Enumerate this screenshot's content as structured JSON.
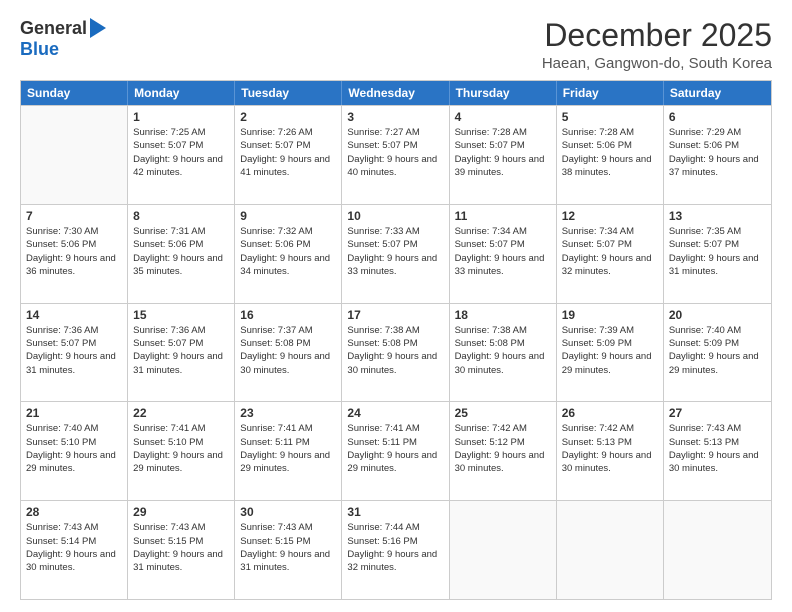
{
  "header": {
    "logo_general": "General",
    "logo_blue": "Blue",
    "month_title": "December 2025",
    "subtitle": "Haean, Gangwon-do, South Korea"
  },
  "weekdays": [
    "Sunday",
    "Monday",
    "Tuesday",
    "Wednesday",
    "Thursday",
    "Friday",
    "Saturday"
  ],
  "rows": [
    [
      {
        "day": "",
        "sunrise": "",
        "sunset": "",
        "daylight": ""
      },
      {
        "day": "1",
        "sunrise": "7:25 AM",
        "sunset": "5:07 PM",
        "daylight": "9 hours and 42 minutes."
      },
      {
        "day": "2",
        "sunrise": "7:26 AM",
        "sunset": "5:07 PM",
        "daylight": "9 hours and 41 minutes."
      },
      {
        "day": "3",
        "sunrise": "7:27 AM",
        "sunset": "5:07 PM",
        "daylight": "9 hours and 40 minutes."
      },
      {
        "day": "4",
        "sunrise": "7:28 AM",
        "sunset": "5:07 PM",
        "daylight": "9 hours and 39 minutes."
      },
      {
        "day": "5",
        "sunrise": "7:28 AM",
        "sunset": "5:06 PM",
        "daylight": "9 hours and 38 minutes."
      },
      {
        "day": "6",
        "sunrise": "7:29 AM",
        "sunset": "5:06 PM",
        "daylight": "9 hours and 37 minutes."
      }
    ],
    [
      {
        "day": "7",
        "sunrise": "7:30 AM",
        "sunset": "5:06 PM",
        "daylight": "9 hours and 36 minutes."
      },
      {
        "day": "8",
        "sunrise": "7:31 AM",
        "sunset": "5:06 PM",
        "daylight": "9 hours and 35 minutes."
      },
      {
        "day": "9",
        "sunrise": "7:32 AM",
        "sunset": "5:06 PM",
        "daylight": "9 hours and 34 minutes."
      },
      {
        "day": "10",
        "sunrise": "7:33 AM",
        "sunset": "5:07 PM",
        "daylight": "9 hours and 33 minutes."
      },
      {
        "day": "11",
        "sunrise": "7:34 AM",
        "sunset": "5:07 PM",
        "daylight": "9 hours and 33 minutes."
      },
      {
        "day": "12",
        "sunrise": "7:34 AM",
        "sunset": "5:07 PM",
        "daylight": "9 hours and 32 minutes."
      },
      {
        "day": "13",
        "sunrise": "7:35 AM",
        "sunset": "5:07 PM",
        "daylight": "9 hours and 31 minutes."
      }
    ],
    [
      {
        "day": "14",
        "sunrise": "7:36 AM",
        "sunset": "5:07 PM",
        "daylight": "9 hours and 31 minutes."
      },
      {
        "day": "15",
        "sunrise": "7:36 AM",
        "sunset": "5:07 PM",
        "daylight": "9 hours and 31 minutes."
      },
      {
        "day": "16",
        "sunrise": "7:37 AM",
        "sunset": "5:08 PM",
        "daylight": "9 hours and 30 minutes."
      },
      {
        "day": "17",
        "sunrise": "7:38 AM",
        "sunset": "5:08 PM",
        "daylight": "9 hours and 30 minutes."
      },
      {
        "day": "18",
        "sunrise": "7:38 AM",
        "sunset": "5:08 PM",
        "daylight": "9 hours and 30 minutes."
      },
      {
        "day": "19",
        "sunrise": "7:39 AM",
        "sunset": "5:09 PM",
        "daylight": "9 hours and 29 minutes."
      },
      {
        "day": "20",
        "sunrise": "7:40 AM",
        "sunset": "5:09 PM",
        "daylight": "9 hours and 29 minutes."
      }
    ],
    [
      {
        "day": "21",
        "sunrise": "7:40 AM",
        "sunset": "5:10 PM",
        "daylight": "9 hours and 29 minutes."
      },
      {
        "day": "22",
        "sunrise": "7:41 AM",
        "sunset": "5:10 PM",
        "daylight": "9 hours and 29 minutes."
      },
      {
        "day": "23",
        "sunrise": "7:41 AM",
        "sunset": "5:11 PM",
        "daylight": "9 hours and 29 minutes."
      },
      {
        "day": "24",
        "sunrise": "7:41 AM",
        "sunset": "5:11 PM",
        "daylight": "9 hours and 29 minutes."
      },
      {
        "day": "25",
        "sunrise": "7:42 AM",
        "sunset": "5:12 PM",
        "daylight": "9 hours and 30 minutes."
      },
      {
        "day": "26",
        "sunrise": "7:42 AM",
        "sunset": "5:13 PM",
        "daylight": "9 hours and 30 minutes."
      },
      {
        "day": "27",
        "sunrise": "7:43 AM",
        "sunset": "5:13 PM",
        "daylight": "9 hours and 30 minutes."
      }
    ],
    [
      {
        "day": "28",
        "sunrise": "7:43 AM",
        "sunset": "5:14 PM",
        "daylight": "9 hours and 30 minutes."
      },
      {
        "day": "29",
        "sunrise": "7:43 AM",
        "sunset": "5:15 PM",
        "daylight": "9 hours and 31 minutes."
      },
      {
        "day": "30",
        "sunrise": "7:43 AM",
        "sunset": "5:15 PM",
        "daylight": "9 hours and 31 minutes."
      },
      {
        "day": "31",
        "sunrise": "7:44 AM",
        "sunset": "5:16 PM",
        "daylight": "9 hours and 32 minutes."
      },
      {
        "day": "",
        "sunrise": "",
        "sunset": "",
        "daylight": ""
      },
      {
        "day": "",
        "sunrise": "",
        "sunset": "",
        "daylight": ""
      },
      {
        "day": "",
        "sunrise": "",
        "sunset": "",
        "daylight": ""
      }
    ]
  ]
}
